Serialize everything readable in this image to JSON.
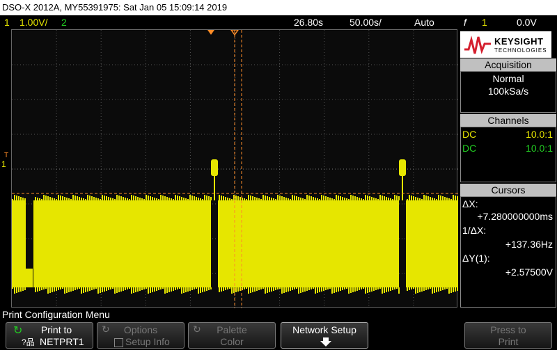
{
  "title_bar": "DSO-X 2012A, MY55391975: Sat Jan 05 15:09:14 2019",
  "status": {
    "ch1_num": "1",
    "ch1_scale": "1.00V/",
    "ch2_num": "2",
    "delay": "26.80s",
    "timebase": "50.00s/",
    "trigger_mode": "Auto",
    "trigger_symbol": "f",
    "trigger_source": "1",
    "trigger_level": "0.0V"
  },
  "brand": {
    "name": "KEYSIGHT",
    "sub": "TECHNOLOGIES"
  },
  "acquisition": {
    "heading": "Acquisition",
    "mode": "Normal",
    "rate": "100kSa/s"
  },
  "channels": {
    "heading": "Channels",
    "ch1": {
      "coupling": "DC",
      "probe": "10.0:1"
    },
    "ch2": {
      "coupling": "DC",
      "probe": "10.0:1"
    }
  },
  "cursors": {
    "heading": "Cursors",
    "dx_label": "ΔX:",
    "dx_value": "+7.280000000ms",
    "inv_dx_label": "1/ΔX:",
    "inv_dx_value": "+137.36Hz",
    "dy_label": "ΔY(1):",
    "dy_value": "+2.57500V"
  },
  "marker": {
    "trigger_t": "T",
    "ch1_ground": "1"
  },
  "menu": {
    "title": "Print Configuration Menu",
    "print_to": "Print to",
    "print_to_value": "NETPRT1",
    "options": "Options",
    "setup_info": "Setup Info",
    "palette": "Palette",
    "palette_value": "Color",
    "network_setup": "Network Setup",
    "press_to": "Press to",
    "print": "Print"
  },
  "colors": {
    "ch1": "#e6e600",
    "ch2": "#22cc22",
    "cursor": "#ff8c28",
    "trigger": "#ff8c28"
  }
}
